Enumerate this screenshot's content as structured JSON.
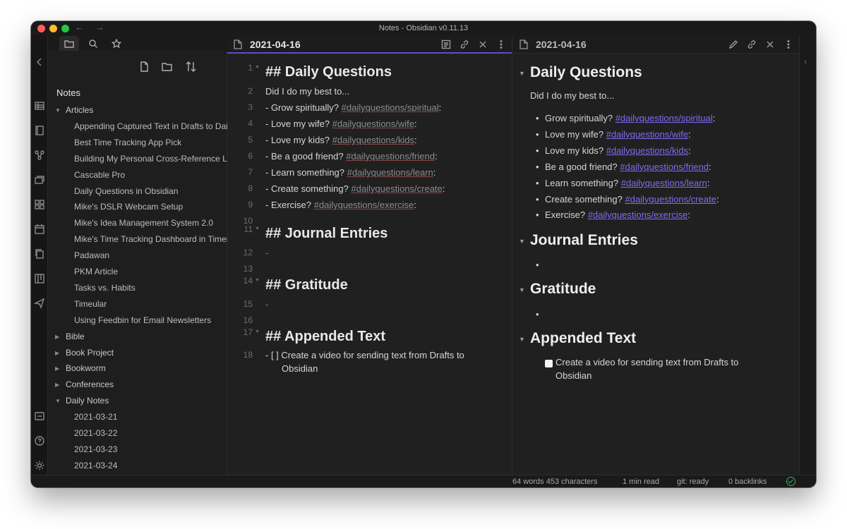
{
  "window": {
    "title": "Notes - Obsidian v0.11.13"
  },
  "nav": {
    "back": "←",
    "forward": "→"
  },
  "sidebar": {
    "vault_name": "Notes",
    "tree": [
      {
        "type": "folder",
        "label": "Articles",
        "expanded": true
      },
      {
        "type": "file",
        "label": "Appending Captured Text in Drafts to Dai"
      },
      {
        "type": "file",
        "label": "Best Time Tracking App Pick"
      },
      {
        "type": "file",
        "label": "Building My Personal Cross-Reference Li"
      },
      {
        "type": "file",
        "label": "Cascable Pro"
      },
      {
        "type": "file",
        "label": "Daily Questions in Obsidian"
      },
      {
        "type": "file",
        "label": "Mike's DSLR Webcam Setup"
      },
      {
        "type": "file",
        "label": "Mike's Idea Management System 2.0"
      },
      {
        "type": "file",
        "label": "Mike's Time Tracking Dashboard in Timer"
      },
      {
        "type": "file",
        "label": "Padawan"
      },
      {
        "type": "file",
        "label": "PKM Article"
      },
      {
        "type": "file",
        "label": "Tasks vs. Habits"
      },
      {
        "type": "file",
        "label": "Timeular"
      },
      {
        "type": "file",
        "label": "Using Feedbin for Email Newsletters"
      },
      {
        "type": "folder",
        "label": "Bible",
        "expanded": false
      },
      {
        "type": "folder",
        "label": "Book Project",
        "expanded": false
      },
      {
        "type": "folder",
        "label": "Bookworm",
        "expanded": false
      },
      {
        "type": "folder",
        "label": "Conferences",
        "expanded": false
      },
      {
        "type": "folder",
        "label": "Daily Notes",
        "expanded": true
      },
      {
        "type": "file",
        "label": "2021-03-21"
      },
      {
        "type": "file",
        "label": "2021-03-22"
      },
      {
        "type": "file",
        "label": "2021-03-23"
      },
      {
        "type": "file",
        "label": "2021-03-24"
      }
    ]
  },
  "editor": {
    "title": "2021-04-16",
    "lines": [
      {
        "n": "1",
        "fold": true,
        "kind": "h2",
        "text": "## Daily Questions"
      },
      {
        "n": "2",
        "kind": "text",
        "text": "Did I do my best to..."
      },
      {
        "n": "3",
        "kind": "tag",
        "prefix": "- Grow spiritually? ",
        "tag": "#dailyquestions/spiritual",
        "suffix": ":"
      },
      {
        "n": "4",
        "kind": "tag",
        "prefix": "- Love my wife? ",
        "tag": "#dailyquestions/wife",
        "suffix": ":"
      },
      {
        "n": "5",
        "kind": "tag",
        "prefix": "- Love my kids? ",
        "tag": "#dailyquestions/kids",
        "suffix": ":"
      },
      {
        "n": "6",
        "kind": "tag",
        "prefix": "- Be a good friend? ",
        "tag": "#dailyquestions/friend",
        "suffix": ":"
      },
      {
        "n": "7",
        "kind": "tag",
        "prefix": "- Learn something? ",
        "tag": "#dailyquestions/learn",
        "suffix": ":"
      },
      {
        "n": "8",
        "kind": "tag",
        "prefix": "- Create something? ",
        "tag": "#dailyquestions/create",
        "suffix": ":"
      },
      {
        "n": "9",
        "kind": "tag",
        "prefix": "- Exercise? ",
        "tag": "#dailyquestions/exercise",
        "suffix": ":"
      },
      {
        "n": "10",
        "kind": "empty",
        "text": ""
      },
      {
        "n": "11",
        "fold": true,
        "kind": "h2",
        "text": "## Journal Entries"
      },
      {
        "n": "12",
        "kind": "dim",
        "text": "-"
      },
      {
        "n": "13",
        "kind": "empty",
        "text": ""
      },
      {
        "n": "14",
        "fold": true,
        "kind": "h2",
        "text": "## Gratitude"
      },
      {
        "n": "15",
        "kind": "dim",
        "text": "-"
      },
      {
        "n": "16",
        "kind": "empty",
        "text": ""
      },
      {
        "n": "17",
        "fold": true,
        "kind": "h2",
        "text": "## Appended Text"
      },
      {
        "n": "18",
        "kind": "task",
        "text": "- [ ] Create a video for sending text from Drafts to",
        "text2": "Obsidian"
      }
    ]
  },
  "preview": {
    "title": "2021-04-16",
    "h_daily": "Daily Questions",
    "intro": "Did I do my best to...",
    "items": [
      {
        "prefix": "Grow spiritually? ",
        "tag": "#dailyquestions/spiritual",
        "suffix": ":"
      },
      {
        "prefix": "Love my wife? ",
        "tag": "#dailyquestions/wife",
        "suffix": ":"
      },
      {
        "prefix": "Love my kids? ",
        "tag": "#dailyquestions/kids",
        "suffix": ":"
      },
      {
        "prefix": "Be a good friend? ",
        "tag": "#dailyquestions/friend",
        "suffix": ":"
      },
      {
        "prefix": "Learn something? ",
        "tag": "#dailyquestions/learn",
        "suffix": ":"
      },
      {
        "prefix": "Create something? ",
        "tag": "#dailyquestions/create",
        "suffix": ":"
      },
      {
        "prefix": "Exercise? ",
        "tag": "#dailyquestions/exercise",
        "suffix": ":"
      }
    ],
    "h_journal": "Journal Entries",
    "h_gratitude": "Gratitude",
    "h_appended": "Appended Text",
    "task": "Create a video for sending text from Drafts to Obsidian",
    "bullet": "•"
  },
  "status": {
    "words": "64 words 453 characters",
    "read_time": "1 min read",
    "git": "git: ready",
    "backlinks": "0 backlinks"
  },
  "colors": {
    "accent": "#7f6df2",
    "bg": "#202020",
    "sync_ok": "#3fae5a"
  }
}
